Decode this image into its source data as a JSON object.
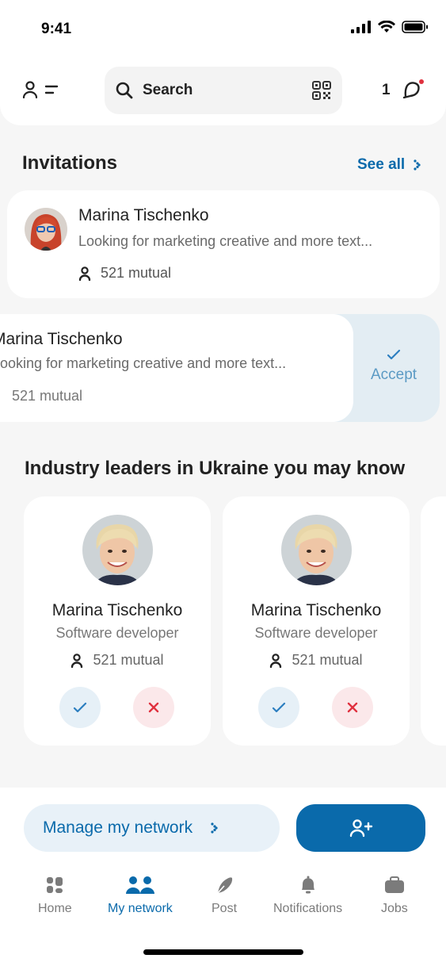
{
  "status": {
    "time": "9:41"
  },
  "search": {
    "label": "Search"
  },
  "messages": {
    "count": "1"
  },
  "invitations": {
    "title": "Invitations",
    "see_all": "See all",
    "items": [
      {
        "name": "Marina Tischenko",
        "desc": "Looking for marketing creative and more text...",
        "mutual": "521 mutual"
      }
    ],
    "swiped": {
      "name": "Marina Tischenko",
      "desc": "Looking for marketing creative and more text...",
      "mutual": "521 mutual",
      "action": "Accept"
    }
  },
  "leaders": {
    "title": "Industry leaders in Ukraine you may know",
    "items": [
      {
        "name": "Marina Tischenko",
        "role": "Software developer",
        "mutual": "521 mutual"
      },
      {
        "name": "Marina Tischenko",
        "role": "Software developer",
        "mutual": "521 mutual"
      }
    ]
  },
  "actions": {
    "manage": "Manage my network"
  },
  "nav": [
    {
      "label": "Home",
      "icon": "home-icon"
    },
    {
      "label": "My network",
      "icon": "network-icon",
      "active": true
    },
    {
      "label": "Post",
      "icon": "feather-icon"
    },
    {
      "label": "Notifications",
      "icon": "bell-icon"
    },
    {
      "label": "Jobs",
      "icon": "briefcase-icon"
    }
  ],
  "colors": {
    "accent": "#0a6aab",
    "accent_light": "#e8f1f8",
    "reject_light": "#fbe8ea",
    "reject": "#e0313f"
  }
}
